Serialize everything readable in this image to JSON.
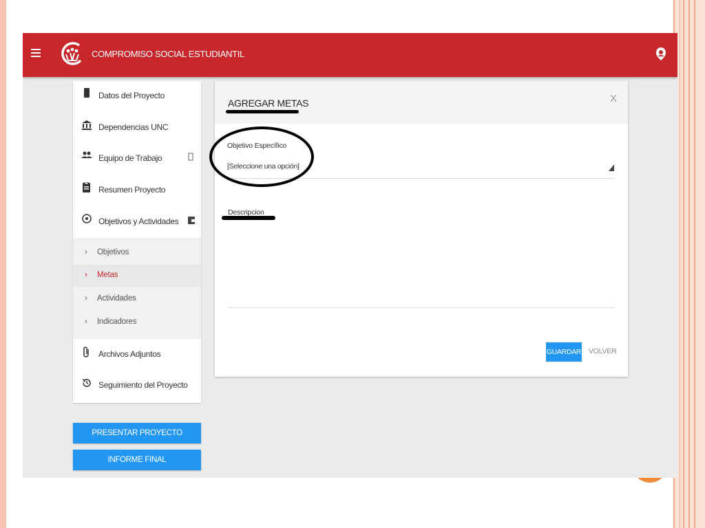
{
  "app": {
    "title": "COMPROMISO SOCIAL ESTUDIANTIL",
    "brand_color": "#c9262c",
    "accent_color": "#2196f3"
  },
  "header": {
    "menu_icon": "hamburger-icon",
    "account_icon": "account-icon"
  },
  "sidebar": {
    "items": [
      {
        "label": "Datos del Proyecto",
        "icon": "phone-icon"
      },
      {
        "label": "Dependencias UNC",
        "icon": "bank-icon"
      },
      {
        "label": "Equipo de Trabajo",
        "icon": "people-icon"
      },
      {
        "label": "Resumen Proyecto",
        "icon": "clipboard-icon"
      },
      {
        "label": "Objetivos y Actividades",
        "icon": "target-icon"
      },
      {
        "label": "Archivos Adjuntos",
        "icon": "paperclip-icon"
      },
      {
        "label": "Seguimiento del Proyecto",
        "icon": "history-icon"
      }
    ],
    "sub_items": [
      {
        "label": "Objetivos",
        "chevron": "›"
      },
      {
        "label": "Metas",
        "chevron": "›"
      },
      {
        "label": "Actividades",
        "chevron": "›"
      },
      {
        "label": "Indicadores",
        "chevron": "›"
      }
    ],
    "active_sub_item": "Metas",
    "buttons": {
      "present": "PRESENTAR PROYECTO",
      "final_report": "INFORME FINAL"
    }
  },
  "modal": {
    "title": "AGREGAR METAS",
    "close": "X",
    "objective_label": "Objetivo Específico",
    "objective_value": "[Seleccione una opción]",
    "description_label": "Descripcion",
    "save_label": "GUARDAR",
    "back_label": "VOLVER"
  }
}
